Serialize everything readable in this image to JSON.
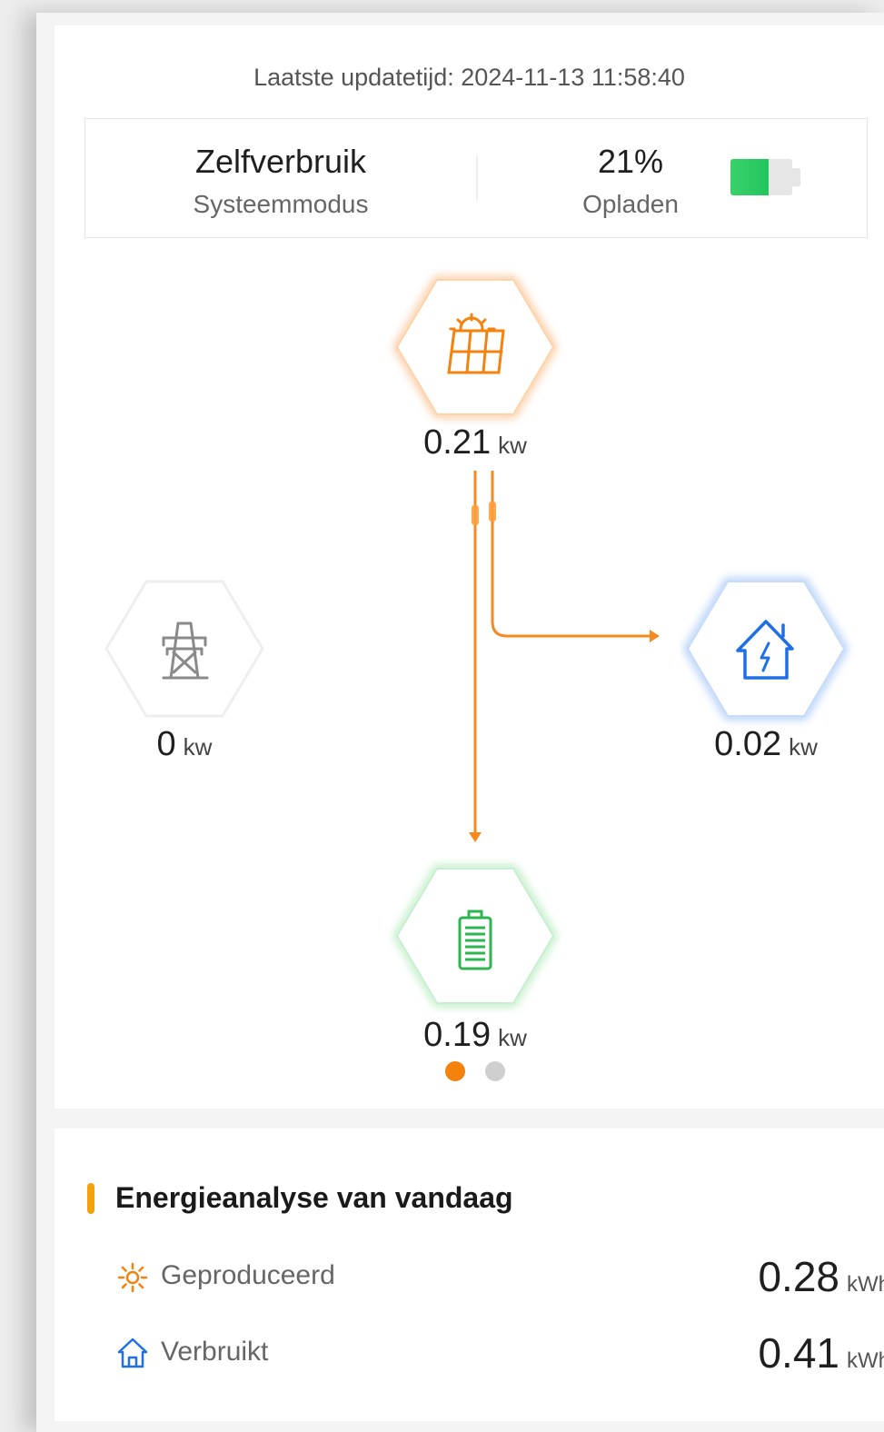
{
  "update": {
    "label": "Laatste updatetijd: 2024-11-13 11:58:40"
  },
  "status": {
    "mode_value": "Zelfverbruik",
    "mode_label": "Systeemmodus",
    "soc_value": "21%",
    "soc_label": "Opladen",
    "soc_fraction": 0.62
  },
  "colors": {
    "solar": "#f5820d",
    "home": "#1f6fe6",
    "battery": "#2eb54f",
    "grid": "#8a8a8a",
    "flow": "#f58a1f",
    "dot_active": "#f5820d",
    "dot_inactive": "#cfcfcf"
  },
  "nodes": {
    "solar": {
      "icon": "solar-panel-icon",
      "value": "0.21",
      "unit": "kw"
    },
    "grid": {
      "icon": "power-tower-icon",
      "value": "0",
      "unit": "kw"
    },
    "home": {
      "icon": "house-lightning-icon",
      "value": "0.02",
      "unit": "kw"
    },
    "battery": {
      "icon": "battery-icon",
      "value": "0.19",
      "unit": "kw"
    }
  },
  "pager": {
    "count": 2,
    "active": 0
  },
  "analysis": {
    "title": "Energieanalyse van vandaag",
    "rows": [
      {
        "icon": "sun-icon",
        "label": "Geproduceerd",
        "value": "0.28",
        "unit": "kWh"
      },
      {
        "icon": "house-icon",
        "label": "Verbruikt",
        "value": "0.41",
        "unit": "kWh"
      }
    ]
  }
}
